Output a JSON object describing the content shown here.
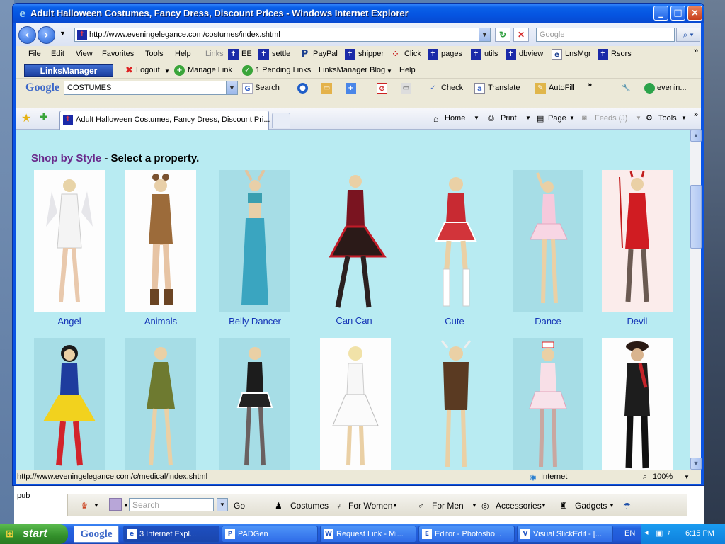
{
  "window": {
    "title": "Adult Halloween Costumes, Fancy Dress, Discount Prices - Windows Internet Explorer"
  },
  "address": {
    "url": "http://www.eveningelegance.com/costumes/index.shtml",
    "search_placeholder": "Google"
  },
  "menu": [
    "File",
    "Edit",
    "View",
    "Favorites",
    "Tools",
    "Help"
  ],
  "links_bar": {
    "label": "Links",
    "items": [
      "EE",
      "settle",
      "PayPal",
      "shipper",
      "Click",
      "pages",
      "utils",
      "dbview",
      "LnsMgr",
      "Rsors"
    ]
  },
  "linksmanager": {
    "logo": "LinksManager",
    "logout": "Logout",
    "manage": "Manage Link",
    "pending": "1 Pending Links",
    "blog": "LinksManager Blog",
    "help": "Help"
  },
  "google_bar": {
    "logo": "Google",
    "query": "COSTUMES",
    "search": "Search",
    "check": "Check",
    "translate": "Translate",
    "autofill": "AutoFill",
    "account": "evenin..."
  },
  "tab": {
    "title": "Adult Halloween Costumes, Fancy Dress, Discount Pri..."
  },
  "commands": {
    "home": "Home",
    "print": "Print",
    "page": "Page",
    "feeds": "Feeds (J)",
    "tools": "Tools"
  },
  "page": {
    "heading_strong": "Shop by Style",
    "heading_rest": " - Select a property.",
    "styles_row1": [
      "Angel",
      "Animals",
      "Belly Dancer",
      "Can Can",
      "Cute",
      "Dance",
      "Devil"
    ]
  },
  "status": {
    "url": "http://www.eveningelegance.com/c/medical/index.shtml",
    "zone": "Internet",
    "zoom": "100%"
  },
  "iebar": {
    "search_placeholder": "Search",
    "go": "Go",
    "costumes": "Costumes",
    "women": "For Women",
    "men": "For Men",
    "accessories": "Accessories",
    "gadgets": "Gadgets"
  },
  "taskbar": {
    "start": "start",
    "google": "Google",
    "tasks": [
      "3 Internet Expl...",
      "PADGen",
      "Request Link - Mi...",
      "Editor - Photosho...",
      "Visual SlickEdit - [..."
    ],
    "lang": "EN",
    "clock": "6:15 PM"
  },
  "desktop": {
    "label_pub": "pub"
  },
  "colors": {
    "page_bg": "#b8ebf2",
    "heading": "#6a2a8c",
    "link": "#1535b7",
    "title_bar": "#0554e0"
  }
}
